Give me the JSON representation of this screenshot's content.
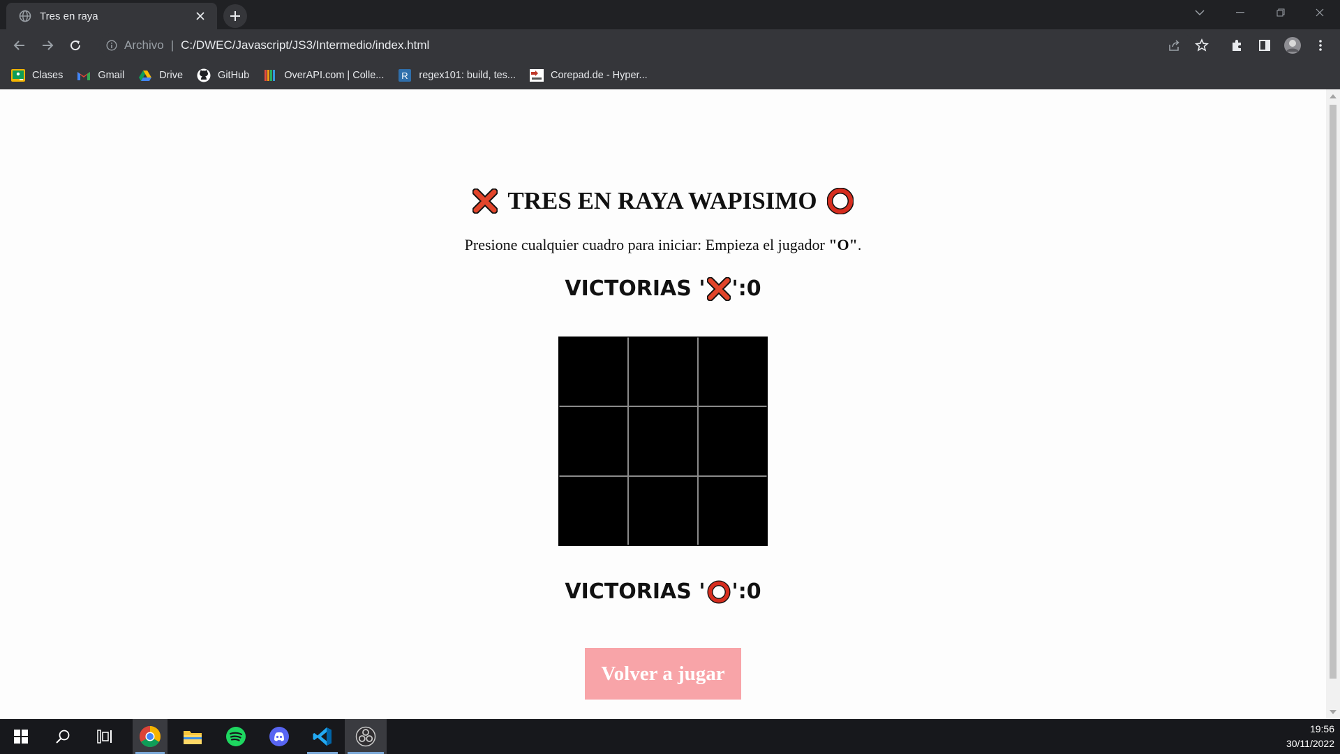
{
  "browser": {
    "tab_title": "Tres en raya",
    "url_scheme": "Archivo",
    "url": "C:/DWEC/Javascript/JS3/Intermedio/index.html",
    "bookmarks": [
      {
        "label": "Clases",
        "icon": "classroom-icon"
      },
      {
        "label": "Gmail",
        "icon": "gmail-icon"
      },
      {
        "label": "Drive",
        "icon": "drive-icon"
      },
      {
        "label": "GitHub",
        "icon": "github-icon"
      },
      {
        "label": "OverAPI.com | Colle...",
        "icon": "overapi-icon"
      },
      {
        "label": "regex101: build, tes...",
        "icon": "regex101-icon"
      },
      {
        "label": "Corepad.de - Hyper...",
        "icon": "corepad-icon"
      }
    ]
  },
  "game": {
    "title": "TRES EN RAYA WAPISIMO",
    "instruction_prefix": "Presione cualquier cuadro para iniciar: Empieza el jugador ",
    "starting_player": "\"O\"",
    "instruction_suffix": ".",
    "wins_label_prefix": "VICTORIAS '",
    "wins_label_suffix": "': ",
    "wins_x": "0",
    "wins_o": "0",
    "board": [
      "",
      "",
      "",
      "",
      "",
      "",
      "",
      "",
      ""
    ],
    "replay_label": "Volver a jugar",
    "colors": {
      "x_mark": "#e2452b",
      "o_mark": "#d62d1f",
      "board": "#000000",
      "grid_lines": "#8a8a8a",
      "replay_bg": "#f8a4a8"
    }
  },
  "taskbar": {
    "time": "19:56",
    "date": "30/11/2022",
    "apps": [
      "windows-start-icon",
      "search-icon",
      "task-view-icon",
      "chrome-icon",
      "file-explorer-icon",
      "spotify-icon",
      "discord-icon",
      "vscode-icon",
      "obs-icon"
    ]
  }
}
